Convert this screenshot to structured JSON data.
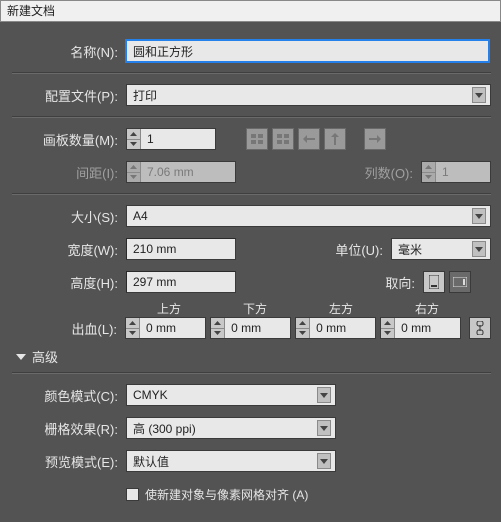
{
  "window_title": "新建文档",
  "name": {
    "label": "名称(N):",
    "value": "圆和正方形"
  },
  "profile": {
    "label": "配置文件(P):",
    "value": "打印"
  },
  "artboards": {
    "count_label": "画板数量(M):",
    "count": "1",
    "spacing_label": "间距(I):",
    "spacing": "7.06 mm",
    "columns_label": "列数(O):",
    "columns": "1"
  },
  "size": {
    "label": "大小(S):",
    "value": "A4"
  },
  "width": {
    "label": "宽度(W):",
    "value": "210 mm"
  },
  "height": {
    "label": "高度(H):",
    "value": "297 mm"
  },
  "units": {
    "label": "单位(U):",
    "value": "毫米"
  },
  "orientation_label": "取向:",
  "bleed": {
    "label": "出血(L):",
    "top": "上方",
    "bottom": "下方",
    "left": "左方",
    "right": "右方",
    "top_v": "0 mm",
    "bottom_v": "0 mm",
    "left_v": "0 mm",
    "right_v": "0 mm"
  },
  "advanced": "高级",
  "color_mode": {
    "label": "颜色模式(C):",
    "value": "CMYK"
  },
  "raster": {
    "label": "栅格效果(R):",
    "value": "高 (300 ppi)"
  },
  "preview": {
    "label": "预览模式(E):",
    "value": "默认值"
  },
  "align_pixel": "使新建对象与像素网格对齐 (A)"
}
